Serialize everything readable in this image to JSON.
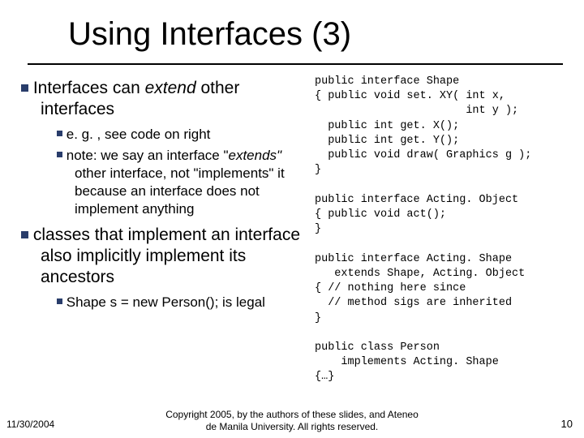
{
  "title": "Using Interfaces (3)",
  "bullets": {
    "p1_pre": "Interfaces can ",
    "p1_em": "extend",
    "p1_post": " other interfaces",
    "p1a": "e. g. , see code on right",
    "p1b_pre": "note: we say an interface \"",
    "p1b_em": "extends\"",
    "p1b_post": " other interface, not \"implements\" it because an interface does not implement anything",
    "p2": "classes that implement an interface also implicitly implement its ancestors",
    "p2a": "Shape s = new Person(); is legal"
  },
  "code": "public interface Shape\n{ public void set. XY( int x,\n                       int y );\n  public int get. X();\n  public int get. Y();\n  public void draw( Graphics g );\n}\n\npublic interface Acting. Object\n{ public void act();\n}\n\npublic interface Acting. Shape\n   extends Shape, Acting. Object\n{ // nothing here since\n  // method sigs are inherited\n}\n\npublic class Person\n    implements Acting. Shape\n{…}",
  "footer": {
    "date": "11/30/2004",
    "copy1": "Copyright 2005, by the authors of these slides, and Ateneo",
    "copy2": "de Manila University. All rights reserved.",
    "num": "10"
  }
}
